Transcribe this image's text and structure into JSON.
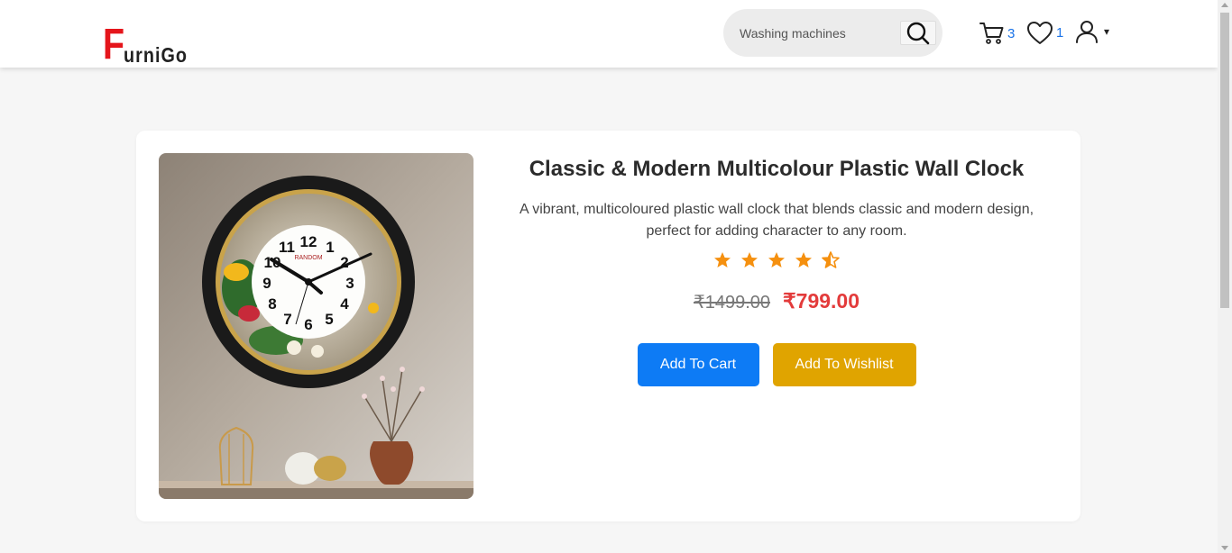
{
  "brand": {
    "first_letter": "F",
    "rest": "urniGo",
    "accent": "#e5151b"
  },
  "search": {
    "placeholder": "Washing machines",
    "icon": "search-icon"
  },
  "nav": {
    "cart_count": "3",
    "wishlist_count": "1",
    "cart_icon": "cart-icon",
    "wishlist_icon": "heart-icon",
    "user_icon": "user-icon",
    "caret": "▾"
  },
  "product": {
    "title": "Classic & Modern Multicolour Plastic Wall Clock",
    "description": "A vibrant, multicoloured plastic wall clock that blends classic and modern design, perfect for adding character to any room.",
    "rating": 4.5,
    "old_price": "₹1499.00",
    "new_price": "₹799.00",
    "clock_brand": "RANDOM",
    "clock_numbers": [
      "12",
      "1",
      "2",
      "3",
      "4",
      "5",
      "6",
      "7",
      "8",
      "9",
      "10",
      "11"
    ],
    "add_to_cart": "Add To Cart",
    "add_to_wishlist": "Add To Wishlist"
  },
  "colors": {
    "cart_button": "#0d7bf5",
    "wishlist_button": "#e0a400",
    "price": "#e33b3b",
    "star": "#f5900f",
    "count": "#1a73e8"
  }
}
